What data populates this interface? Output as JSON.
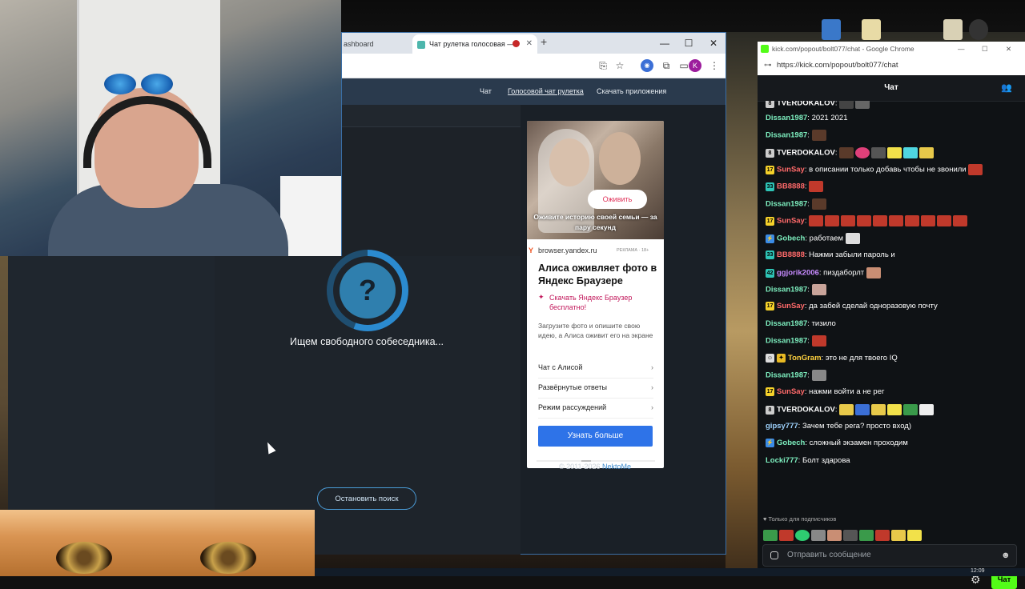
{
  "browser": {
    "tabs": [
      {
        "label": "ashboard"
      },
      {
        "label": "Чат рулетка голосовая —"
      }
    ],
    "window_controls": {
      "minimize": "—",
      "maximize": "☐",
      "close": "✕"
    }
  },
  "site": {
    "nav": {
      "chat": "Чат",
      "voice_roulette": "Голосовой чат рулетка",
      "download_apps": "Скачать приложения"
    },
    "search": {
      "icon_text": "?",
      "status": "Ищем свободного собеседника...",
      "stop_button": "Остановить поиск"
    },
    "footer": {
      "copyright": "© 2011-2026",
      "brand": "NektoMe"
    }
  },
  "ad": {
    "photo_button": "Оживить",
    "photo_caption": "Оживите историю своей семьи — за пару секунд",
    "domain": "browser.yandex.ru",
    "label": "РЕКЛАМА · 18+",
    "title": "Алиса оживляет фото в Яндекс Браузере",
    "download_link": "Скачать Яндекс Браузер бесплатно!",
    "description": "Загрузите фото и опишите свою идею, а Алиса оживит его на экране",
    "items": [
      {
        "label": "Чат с Алисой"
      },
      {
        "label": "Развёрнутые ответы"
      },
      {
        "label": "Режим рассуждений"
      }
    ],
    "cta": "Узнать больше"
  },
  "kick": {
    "window_title": "kick.com/popout/bolt077/chat - Google Chrome",
    "url": "https://kick.com/popout/bolt077/chat",
    "header_title": "Чат",
    "messages": [
      {
        "user": "TVERDOKALOV",
        "color": "#ffffff",
        "text": ""
      },
      {
        "user": "Dissan1987",
        "color": "#7ef0c0",
        "text": "2021 2021"
      },
      {
        "user": "Dissan1987",
        "color": "#7ef0c0",
        "text": ""
      },
      {
        "user": "TVERDOKALOV",
        "color": "#ffffff",
        "text": ""
      },
      {
        "user": "SunSay",
        "color": "#ff6a6a",
        "text": "в описании только добавь чтобы не звонили"
      },
      {
        "user": "BB8888",
        "color": "#ff6a6a",
        "text": ""
      },
      {
        "user": "Dissan1987",
        "color": "#7ef0c0",
        "text": ""
      },
      {
        "user": "SunSay",
        "color": "#ff6a6a",
        "text": ""
      },
      {
        "user": "Gobech",
        "color": "#7ef0c0",
        "text": "работаем"
      },
      {
        "user": "BB8888",
        "color": "#ff6a6a",
        "text": "Нажми забыли пароль и"
      },
      {
        "user": "ggjorik2006",
        "color": "#c78bff",
        "text": "пиздаборлт"
      },
      {
        "user": "Dissan1987",
        "color": "#7ef0c0",
        "text": ""
      },
      {
        "user": "SunSay",
        "color": "#ff6a6a",
        "text": "да забей сделай одноразовую почту"
      },
      {
        "user": "Dissan1987",
        "color": "#7ef0c0",
        "text": "тизило"
      },
      {
        "user": "Dissan1987",
        "color": "#7ef0c0",
        "text": ""
      },
      {
        "user": "TonGram",
        "color": "#ffd23f",
        "text": "это не для твоего IQ"
      },
      {
        "user": "Dissan1987",
        "color": "#7ef0c0",
        "text": ""
      },
      {
        "user": "SunSay",
        "color": "#ff6a6a",
        "text": "нажми войти а не рег"
      },
      {
        "user": "TVERDOKALOV",
        "color": "#ffffff",
        "text": ""
      },
      {
        "user": "gipsy777",
        "color": "#9fd4ff",
        "text": "Зачем тебе рега? просто вход)"
      },
      {
        "user": "Gobech",
        "color": "#7ef0c0",
        "text": "сложный экзамен проходим"
      },
      {
        "user": "Locki777",
        "color": "#7ef0c0",
        "text": "Болт здарова"
      }
    ],
    "subscriber_only": "Только для подписчиков",
    "input_placeholder": "Отправить сообщение",
    "send_button": "Чат"
  },
  "taskbar": {
    "time": "12:09"
  },
  "colors": {
    "accent": "#2e73e8",
    "kick_green": "#53fc18",
    "site_bg": "#1f252c",
    "link_pink": "#c2185b"
  }
}
